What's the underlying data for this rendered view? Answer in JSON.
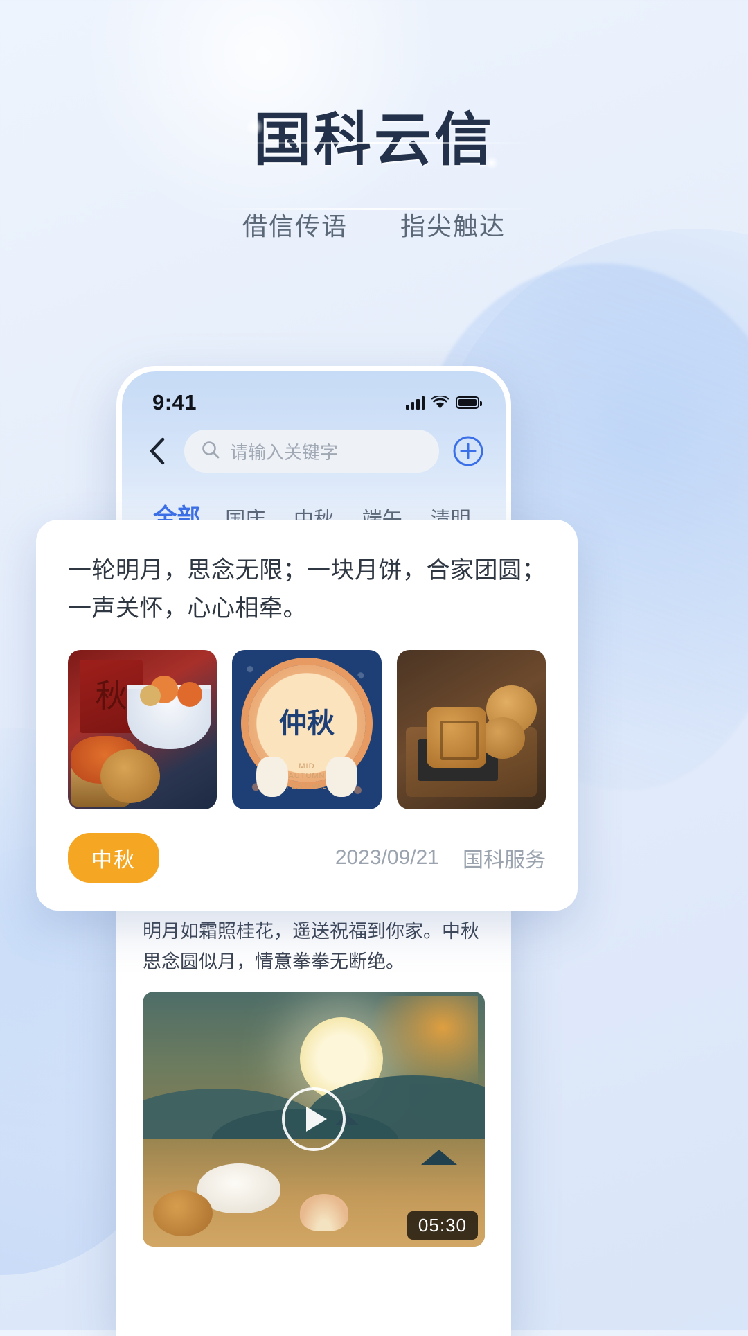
{
  "hero": {
    "title": "国科云信",
    "subtitle_left": "借信传语",
    "subtitle_right": "指尖触达"
  },
  "phone": {
    "status": {
      "time": "9:41",
      "signal_icon": "signal-bars-icon",
      "wifi_icon": "wifi-icon",
      "battery_icon": "battery-icon"
    },
    "nav": {
      "back_icon": "back-chevron-icon",
      "add_icon": "plus-circle-icon"
    },
    "search": {
      "placeholder": "请输入关键字",
      "value": "",
      "icon": "search-icon"
    },
    "tabs": [
      {
        "label": "全部",
        "active": true
      },
      {
        "label": "国庆",
        "active": false
      },
      {
        "label": "中秋",
        "active": false
      },
      {
        "label": "端午",
        "active": false
      },
      {
        "label": "清明",
        "active": false
      }
    ],
    "feed": [
      {
        "text": "一轮明月，思念无限；一块月饼，合家团圆；一声关怀，心心相牵。"
      },
      {
        "text": "明月如霜照桂花，遥送祝福到你家。中秋思念圆似月，情意拳拳无断绝。",
        "video": {
          "duration": "05:30",
          "play_icon": "play-button-icon"
        }
      }
    ]
  },
  "card": {
    "text": "一轮明月，思念无限；一块月饼，合家团圆；一声关怀，心心相牵。",
    "images": [
      {
        "alt": "秋-crab-fruit-photo"
      },
      {
        "alt": "仲秋-poster",
        "poster_title": "仲秋",
        "poster_sub": "MID\nAUTUMN\nFESTIVAL"
      },
      {
        "alt": "mooncake-wood-tray-photo"
      }
    ],
    "tag": "中秋",
    "date": "2023/09/21",
    "source": "国科服务"
  },
  "colors": {
    "accent_blue": "#3b6fe8",
    "tag_orange": "#f5a623",
    "title_navy": "#23324a",
    "muted_gray": "#9aa3ae"
  }
}
